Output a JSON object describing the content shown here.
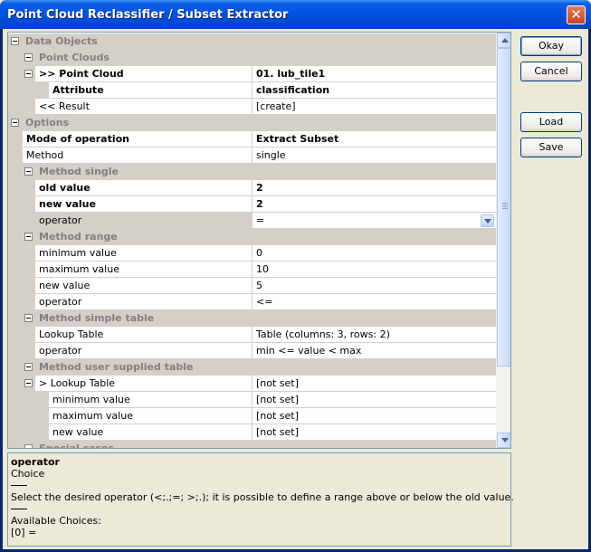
{
  "window": {
    "title": "Point Cloud Reclassifier / Subset Extractor",
    "close_glyph": "✕"
  },
  "buttons": {
    "okay": "Okay",
    "cancel": "Cancel",
    "load": "Load",
    "save": "Save"
  },
  "grid": {
    "rows": [
      {
        "type": "category",
        "level": 0,
        "name": "Data Objects",
        "expander": true
      },
      {
        "type": "category",
        "level": 1,
        "name": "Point Clouds",
        "expander": true
      },
      {
        "type": "prop",
        "level": 1,
        "name": ">> Point Cloud",
        "value": "01. lub_tile1",
        "bold": true,
        "expander": true
      },
      {
        "type": "prop",
        "level": 2,
        "name": "Attribute",
        "value": "classification",
        "bold": true
      },
      {
        "type": "prop",
        "level": 1,
        "name": "<< Result",
        "value": "[create]"
      },
      {
        "type": "category",
        "level": 0,
        "name": "Options",
        "expander": true
      },
      {
        "type": "prop",
        "level": 0,
        "name": "Mode of operation",
        "value": "Extract Subset",
        "bold": true
      },
      {
        "type": "prop",
        "level": 0,
        "name": "Method",
        "value": "single"
      },
      {
        "type": "category",
        "level": 1,
        "name": "Method single",
        "expander": true
      },
      {
        "type": "prop",
        "level": 1,
        "name": "old value",
        "value": "2",
        "bold": true
      },
      {
        "type": "prop",
        "level": 1,
        "name": "new value",
        "value": "2",
        "bold": true
      },
      {
        "type": "prop",
        "level": 1,
        "name": "operator",
        "value": "=",
        "selected": true,
        "dropdown": true
      },
      {
        "type": "category",
        "level": 1,
        "name": "Method range",
        "expander": true
      },
      {
        "type": "prop",
        "level": 1,
        "name": "minimum value",
        "value": "0"
      },
      {
        "type": "prop",
        "level": 1,
        "name": "maximum value",
        "value": "10"
      },
      {
        "type": "prop",
        "level": 1,
        "name": "new value",
        "value": "5"
      },
      {
        "type": "prop",
        "level": 1,
        "name": "operator",
        "value": "<="
      },
      {
        "type": "category",
        "level": 1,
        "name": "Method simple table",
        "expander": true
      },
      {
        "type": "prop",
        "level": 1,
        "name": "Lookup Table",
        "value": "Table (columns: 3, rows: 2)"
      },
      {
        "type": "prop",
        "level": 1,
        "name": "operator",
        "value": "min <= value < max"
      },
      {
        "type": "category",
        "level": 1,
        "name": "Method user supplied table",
        "expander": true
      },
      {
        "type": "prop",
        "level": 1,
        "name": "> Lookup Table",
        "value": "[not set]",
        "expander": true
      },
      {
        "type": "prop",
        "level": 2,
        "name": "minimum value",
        "value": "[not set]"
      },
      {
        "type": "prop",
        "level": 2,
        "name": "maximum value",
        "value": "[not set]"
      },
      {
        "type": "prop",
        "level": 2,
        "name": "new value",
        "value": "[not set]"
      },
      {
        "type": "category",
        "level": 1,
        "name": "Special cases",
        "expander": true
      }
    ]
  },
  "description": {
    "title": "operator",
    "type": "Choice",
    "text": "Select the desired operator (<;.;=; >;.); it is possible to define a range above or below the old value.",
    "choices_label": "Available Choices:",
    "choice_0": "[0] ="
  },
  "colors": {
    "titlebar": "#0055e5",
    "category_bg": "#d4d0c8",
    "selected_bg": "#d4d0c8"
  }
}
